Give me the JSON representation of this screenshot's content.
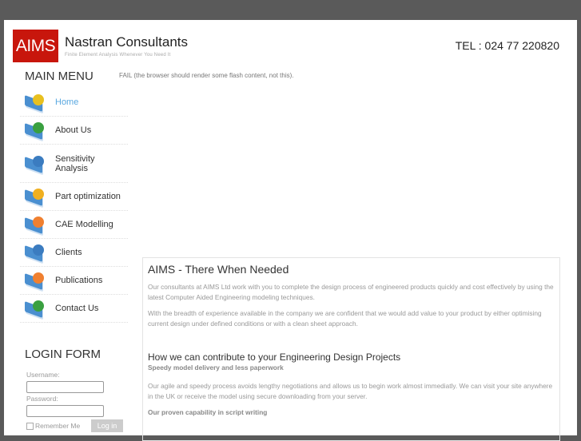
{
  "header": {
    "logo_text": "AIMS",
    "company": "Nastran Consultants",
    "tagline": "Finite Element Analysis Whenever You Need It",
    "tel": "TEL : 024 77 220820"
  },
  "menu": {
    "title": "MAIN MENU",
    "items": [
      {
        "label": "Home",
        "icon": "puzzle-icon",
        "color": "#e8c020",
        "active": true
      },
      {
        "label": "About Us",
        "icon": "user-icon",
        "color": "#3aa040"
      },
      {
        "label": "Sensitivity Analysis",
        "icon": "globe-icon",
        "color": "#3b7cc0"
      },
      {
        "label": "Part optimization",
        "icon": "arrow-icon",
        "color": "#f0b020"
      },
      {
        "label": "CAE Modelling",
        "icon": "lifebuoy-icon",
        "color": "#f08030"
      },
      {
        "label": "Clients",
        "icon": "globe-icon",
        "color": "#3b7cc0"
      },
      {
        "label": "Publications",
        "icon": "lifebuoy-icon",
        "color": "#f08030"
      },
      {
        "label": "Contact Us",
        "icon": "user-icon",
        "color": "#3aa040"
      }
    ]
  },
  "flash_fallback": "FAIL (the browser should render some flash content, not this).",
  "content": {
    "title": "AIMS - There When Needed",
    "p1": "Our consultants at AIMS Ltd work with you to complete the design process of engineered products quickly and cost effectively by using the latest Computer Aided Engineering modeling techniques.",
    "p2": "With the breadth of experience available in the company we are confident that we would add value to your product by either optimising current design under defined conditions or with a clean sheet approach.",
    "h2": "How we can contribute to your Engineering Design Projects",
    "s1": "Speedy model delivery and less paperwork",
    "p3": "Our agile and speedy process avoids lengthy negotiations and allows us to begin work almost immediatly. We can visit your site anywhere in the UK or receive the model using secure downloading from your server.",
    "s2": "Our proven capability in script writing"
  },
  "login": {
    "title": "LOGIN FORM",
    "username_label": "Username:",
    "username_value": "",
    "password_label": "Password:",
    "password_value": "",
    "remember_label": "Remember Me",
    "button": "Log in"
  }
}
